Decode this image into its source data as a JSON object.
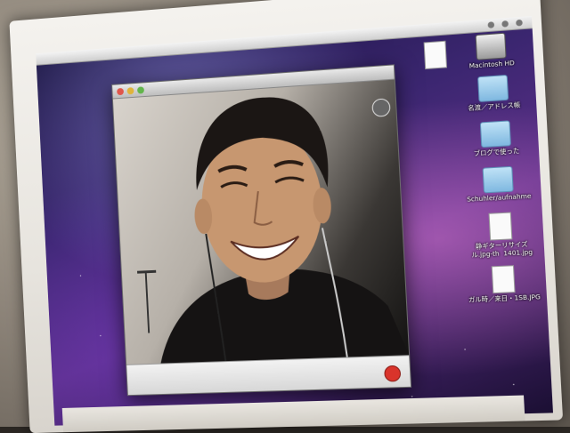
{
  "photo": {
    "subject": "",
    "scene": ""
  },
  "desktop": {
    "icons": [
      {
        "name": "document-icon",
        "label": "",
        "kind": "doc"
      },
      {
        "name": "hard-drive-icon",
        "label": "Macintosh HD",
        "kind": "drive"
      },
      {
        "name": "folder-icon",
        "label": "名渡／アドレス帳",
        "kind": "folder"
      },
      {
        "name": "folder-icon",
        "label": "ブログで使った",
        "kind": "folder"
      },
      {
        "name": "folder-icon",
        "label": "Schuhler/aufnahme",
        "kind": "folder"
      },
      {
        "name": "image-file-icon",
        "label": "静ギターリサイズ\nル.jpg-th  1401.jpg",
        "kind": "doc"
      },
      {
        "name": "image-file-icon",
        "label": "ガル時／来日・1SB.JPG",
        "kind": "doc"
      }
    ]
  },
  "video_window": {
    "title": ""
  },
  "colors": {
    "end_call": "#d9342b",
    "folder": "#9ccbea",
    "wallpaper_accent": "#c06bd0"
  }
}
